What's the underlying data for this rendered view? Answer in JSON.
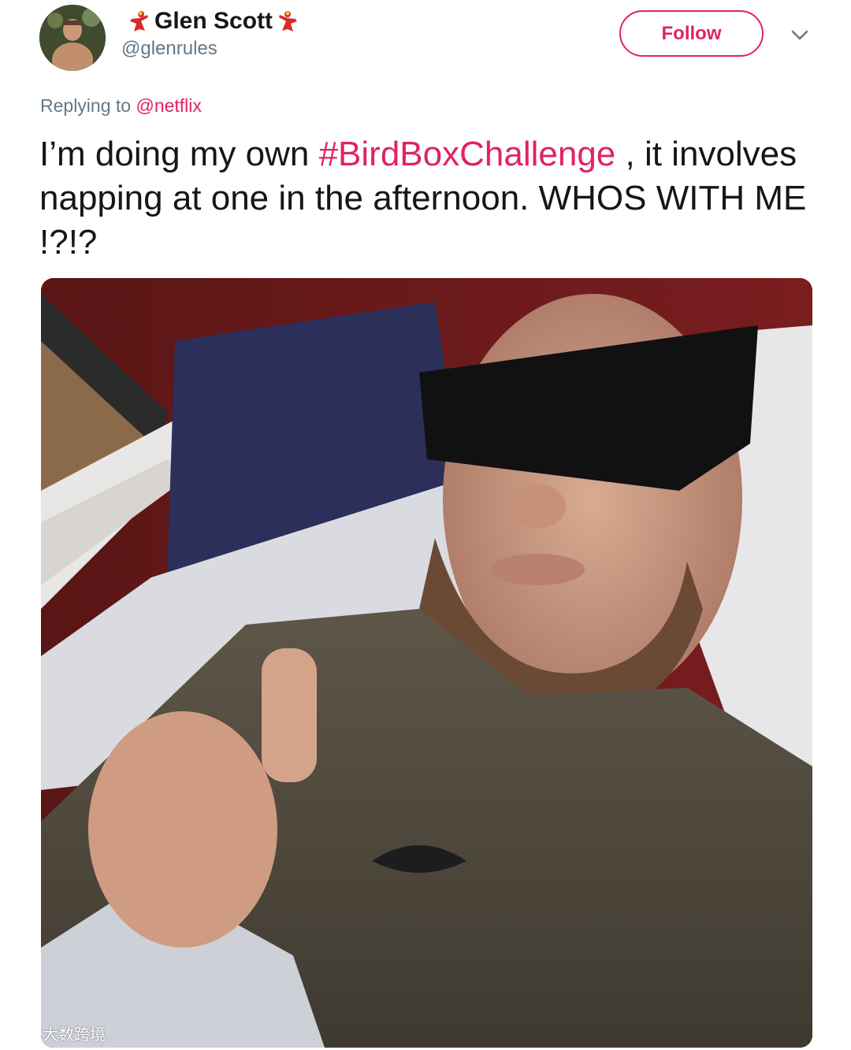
{
  "user": {
    "display_name": "Glen Scott",
    "handle": "@glenrules",
    "emoji_left": "dancer-emoji-icon",
    "emoji_right": "dancer-emoji-icon"
  },
  "follow_button": {
    "label": "Follow"
  },
  "menu": {
    "icon": "chevron-down-icon"
  },
  "reply": {
    "prefix": "Replying to",
    "mention": "@netflix"
  },
  "tweet": {
    "text_before": "I’m doing my own ",
    "hashtag": "#BirdBoxChallenge",
    "text_after": " , it involves napping at one in the afternoon. WHOS WITH ME !?!?"
  },
  "watermark": {
    "text": "大数跨境"
  },
  "colors": {
    "accent": "#e0245e",
    "secondary_text": "#657786",
    "primary_text": "#14171a"
  }
}
